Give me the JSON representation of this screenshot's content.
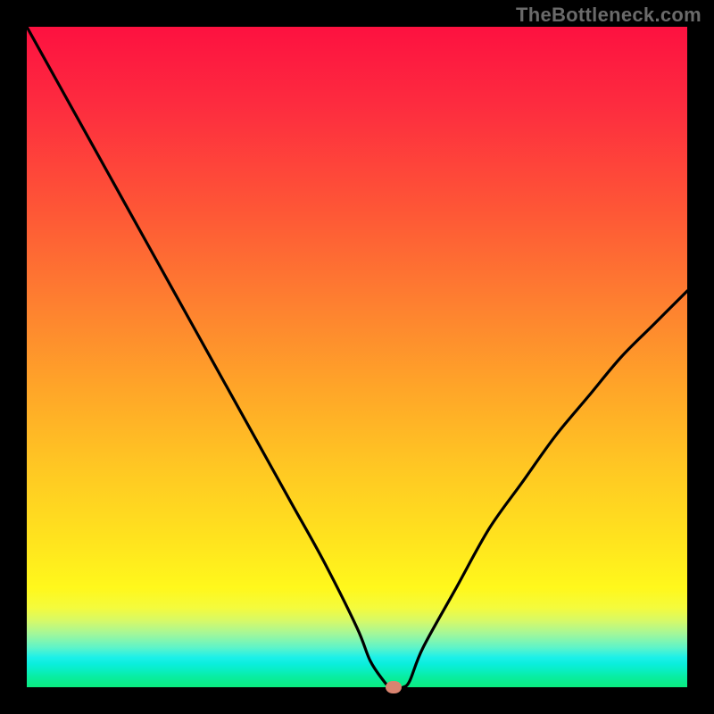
{
  "watermark": "TheBottleneck.com",
  "chart_data": {
    "type": "line",
    "title": "",
    "xlabel": "",
    "ylabel": "",
    "xlim": [
      0,
      100
    ],
    "ylim": [
      0,
      100
    ],
    "x": [
      0,
      5,
      10,
      15,
      20,
      25,
      30,
      35,
      40,
      45,
      50,
      52,
      54,
      55,
      56,
      57,
      58,
      60,
      65,
      70,
      75,
      80,
      85,
      90,
      95,
      100
    ],
    "values": [
      100,
      91,
      82,
      73,
      64,
      55,
      46,
      37,
      28,
      19,
      9,
      4,
      1,
      0,
      0,
      0,
      1,
      6,
      15,
      24,
      31,
      38,
      44,
      50,
      55,
      60
    ],
    "optimum": {
      "x": 55.5,
      "y": 0
    },
    "gradient_meaning": "color indicates bottleneck severity: green = balanced, red = severe bottleneck"
  }
}
